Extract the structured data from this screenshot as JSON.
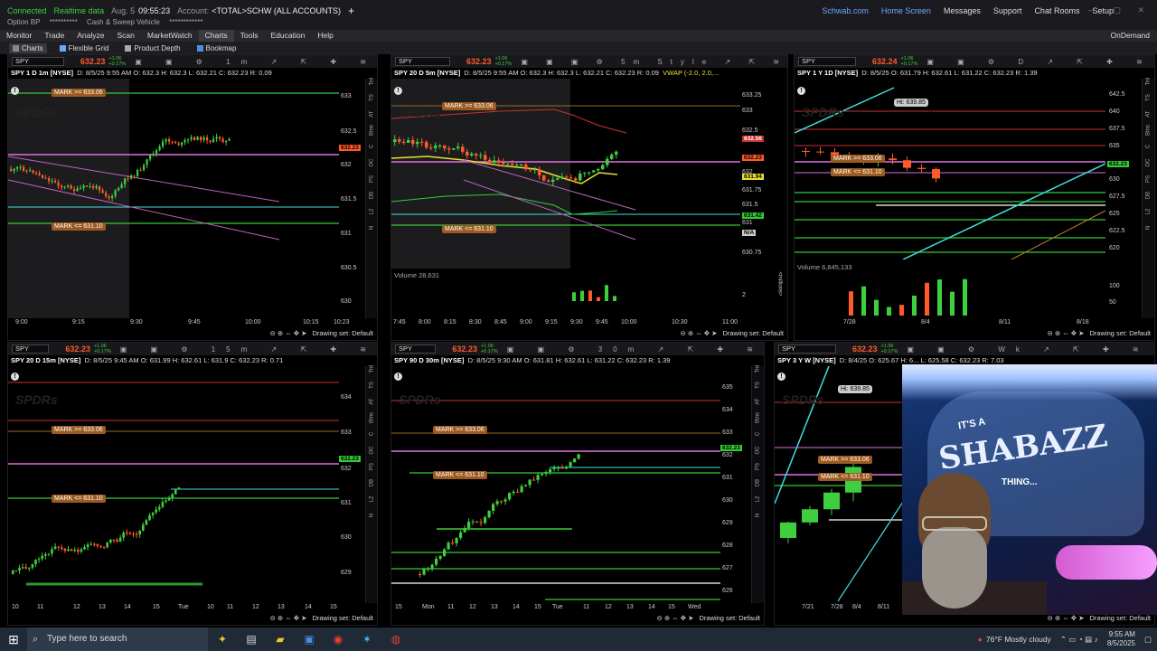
{
  "status": {
    "connected": "Connected",
    "realtime": "Realtime data",
    "date": "Aug. 5",
    "time": "09:55:23",
    "account_label": "Account:",
    "account": "<TOTAL>SCHW (ALL ACCOUNTS)",
    "add": "+",
    "links": [
      "Schwab.com",
      "Home Screen",
      "Messages",
      "Support",
      "Chat Rooms",
      "Setup"
    ],
    "option_bp_label": "Option BP",
    "option_bp_value": "**********",
    "cash_label": "Cash & Sweep Vehicle",
    "cash_value": "************"
  },
  "menu": {
    "items": [
      "Monitor",
      "Trade",
      "Analyze",
      "Scan",
      "MarketWatch",
      "Charts",
      "Tools",
      "Education",
      "Help"
    ],
    "active": "Charts",
    "ondemand": "OnDemand"
  },
  "subbar": {
    "items": [
      "Charts",
      "Flexible Grid",
      "Product Depth",
      "Bookmap"
    ]
  },
  "panes": [
    {
      "symbol": "SPY",
      "price": "632.23",
      "chg1": "+1.06",
      "chg2": "+0.17%",
      "info": "SPY 1 D 1m [NYSE]",
      "ohlc": "D: 8/5/25 9:55 AM  O: 632.3  H: 632.3  L: 632.21  C: 632.23  R: 0.09",
      "interval": "1m",
      "xticks": [
        "9:00",
        "9:15",
        "9:30",
        "9:45",
        "10:00",
        "10:15",
        "10:23"
      ],
      "yticks": [
        "633",
        "632.5",
        "632",
        "631.5",
        "631",
        "630.5",
        "630"
      ],
      "mark_hi": "MARK >= 633.06",
      "mark_lo": "MARK <= 631.10",
      "price_tag": "632.23",
      "drawing_set": "Drawing set: Default"
    },
    {
      "symbol": "SPY",
      "price": "632.23",
      "chg1": "+1.06",
      "chg2": "+0.17%",
      "info": "SPY 20 D 5m [NYSE]",
      "ohlc": "D: 8/5/25 9:55 AM  O: 632.3  H: 632.3  L: 632.21  C: 632.23  R: 0.09",
      "study": "VWAP (-2.0, 2.0,...",
      "interval": "5m",
      "style": "Style",
      "xticks": [
        "7:45",
        "8:00",
        "8:15",
        "8:30",
        "8:45",
        "9:00",
        "9:15",
        "9:30",
        "9:45",
        "10:00",
        "10:30",
        "11:00"
      ],
      "yticks": [
        "633.25",
        "633",
        "632.5",
        "632",
        "631.75",
        "631.5",
        "631",
        "630.75"
      ],
      "tags": [
        "632.56",
        "632.23",
        "631.94",
        "631.42",
        "N/A"
      ],
      "mark_hi": "MARK >= 633.06",
      "mark_lo": "MARK <= 631.10",
      "volume_label": "Volume",
      "volume_value": "28,631",
      "vol_tick": "2",
      "millions": "<millions>",
      "drawing_set": "Drawing set: Default"
    },
    {
      "symbol": "SPY",
      "price": "632.24",
      "chg1": "+1.06",
      "chg2": "+0.17%",
      "info": "SPY 1 Y 1D [NYSE]",
      "ohlc": "D: 8/5/25  O: 631.79  H: 632.61  L: 631.22  C: 632.23  R: 1.39",
      "interval": "D",
      "xticks": [
        "7/28",
        "8/4",
        "8/11",
        "8/18"
      ],
      "yticks": [
        "642.5",
        "640",
        "637.5",
        "635",
        "632.5",
        "630",
        "627.5",
        "625",
        "622.5",
        "620"
      ],
      "hi": "Hi: 639.85",
      "price_tag": "632.23",
      "mark_hi": "MARK >= 633.06",
      "mark_lo": "MARK <= 631.10",
      "volume_label": "Volume",
      "volume_value": "6,845,133",
      "vol_ticks": [
        "100",
        "50"
      ],
      "millions": "<millions>",
      "drawing_set": "Drawing set: Default"
    },
    {
      "symbol": "SPY",
      "price": "632.23",
      "chg1": "+1.06",
      "chg2": "+0.17%",
      "info": "SPY 20 D 15m [NYSE]",
      "ohlc": "D: 8/5/25 9:45 AM  O: 631.99  H: 632.61  L: 631.9  C: 632.23  R: 0.71",
      "interval": "15m",
      "xticks": [
        "10",
        "11",
        "12",
        "13",
        "14",
        "15",
        "Tue",
        "10",
        "11",
        "12",
        "13",
        "14",
        "15"
      ],
      "yticks": [
        "634",
        "633",
        "632",
        "631",
        "630",
        "629"
      ],
      "price_tag": "632.23",
      "mark_hi": "MARK >= 633.06",
      "mark_lo": "MARK <= 631.10",
      "drawing_set": "Drawing set: Default"
    },
    {
      "symbol": "SPY",
      "price": "632.23",
      "chg1": "+1.06",
      "chg2": "+0.17%",
      "info": "SPY 90 D 30m [NYSE]",
      "ohlc": "D: 8/5/25 9:30 AM  O: 631.81  H: 632.61  L: 631.22  C: 632.23  R: 1.39",
      "interval": "30m",
      "xticks": [
        "15",
        "Mon",
        "11",
        "12",
        "13",
        "14",
        "15",
        "Tue",
        "11",
        "12",
        "13",
        "14",
        "15",
        "Wed"
      ],
      "yticks": [
        "635",
        "634",
        "633",
        "632",
        "631",
        "630",
        "629",
        "628",
        "627",
        "626"
      ],
      "price_tag": "632.23",
      "mark_hi": "MARK >= 633.06",
      "mark_lo": "MARK <= 631.10",
      "drawing_set": "Drawing set: Default"
    },
    {
      "symbol": "SPY",
      "price": "632.23",
      "chg1": "+1.06",
      "chg2": "+0.17%",
      "info": "SPY 3 Y W [NYSE]",
      "ohlc": "D: 8/4/25  O: 625.67  H: 6...  L: 625.58  C: 632.23  R: 7.03",
      "interval": "Wk",
      "xticks": [
        "7/21",
        "7/28",
        "8/4",
        "8/11"
      ],
      "hi": "Hi: 639.85",
      "mark_hi": "MARK >= 633.06",
      "mark_lo": "MARK <= 631.10",
      "drawing_set": "Drawing set: Default"
    }
  ],
  "side_tools": [
    "Trd",
    "TS",
    "AT",
    "Btns",
    "C",
    "OC",
    "PS",
    "DB",
    "L2",
    "N"
  ],
  "webcam": {
    "line1": "IT'S A",
    "line2": "SHABAZZ",
    "line3": "THING..."
  },
  "taskbar": {
    "search_placeholder": "Type here to search",
    "weather": "76°F  Mostly cloudy",
    "time": "9:55 AM",
    "date": "8/5/2025"
  },
  "colors": {
    "green": "#3ecf3e",
    "red": "#ff5a2a",
    "magenta": "#e070e0",
    "cyan": "#3fe0e0",
    "mark": "#9c5a20",
    "vwap": "#e8e030",
    "line_green": "#33cc33",
    "accent": "#6aa9ff"
  }
}
